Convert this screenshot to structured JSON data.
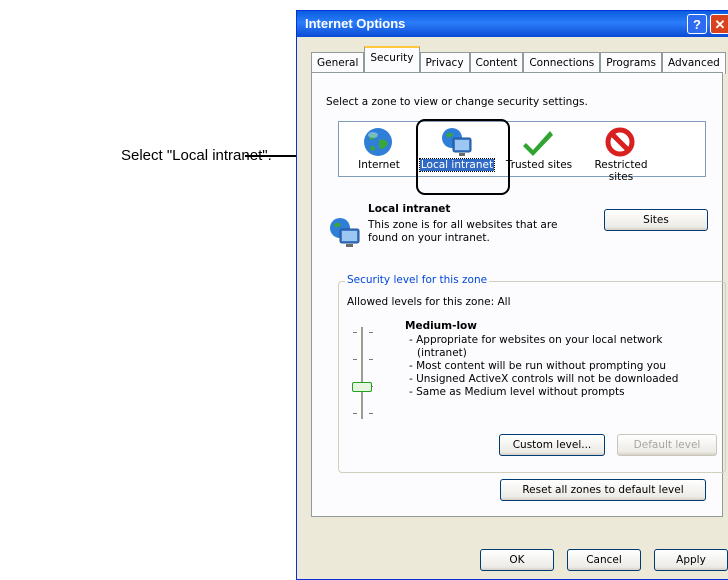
{
  "callout": {
    "text": "Select \"Local intranet\"."
  },
  "window": {
    "title": "Internet Options",
    "help_glyph": "?",
    "close_glyph": "✕"
  },
  "tabs": [
    {
      "label": "General"
    },
    {
      "label": "Security"
    },
    {
      "label": "Privacy"
    },
    {
      "label": "Content"
    },
    {
      "label": "Connections"
    },
    {
      "label": "Programs"
    },
    {
      "label": "Advanced"
    }
  ],
  "security": {
    "instruction": "Select a zone to view or change security settings.",
    "zones": [
      {
        "label": "Internet",
        "icon": "globe-icon"
      },
      {
        "label": "Local intranet",
        "icon": "intranet-globe-monitor-icon",
        "selected": true
      },
      {
        "label": "Trusted sites",
        "icon": "green-check-icon"
      },
      {
        "label": "Restricted sites",
        "icon": "red-prohibited-icon"
      }
    ],
    "zone_title": "Local intranet",
    "zone_desc_line1": "This zone is for all websites that are",
    "zone_desc_line2": "found on your intranet.",
    "sites_button": "Sites",
    "level_group_title": "Security level for this zone",
    "allowed_levels": "Allowed levels for this zone: All",
    "level_name": "Medium-low",
    "level_desc": [
      "- Appropriate for websites on your local network",
      "(intranet)",
      "- Most content will be run without prompting you",
      "- Unsigned ActiveX controls will not be downloaded",
      "- Same as Medium level without prompts"
    ],
    "custom_level_button": "Custom level...",
    "default_level_button": "Default level",
    "reset_button": "Reset all zones to default level"
  },
  "footer": {
    "ok": "OK",
    "cancel": "Cancel",
    "apply": "Apply"
  },
  "colors": {
    "titlebar": "#0a5ee0",
    "selection": "#316ac5",
    "group_legend": "#0046d5"
  }
}
